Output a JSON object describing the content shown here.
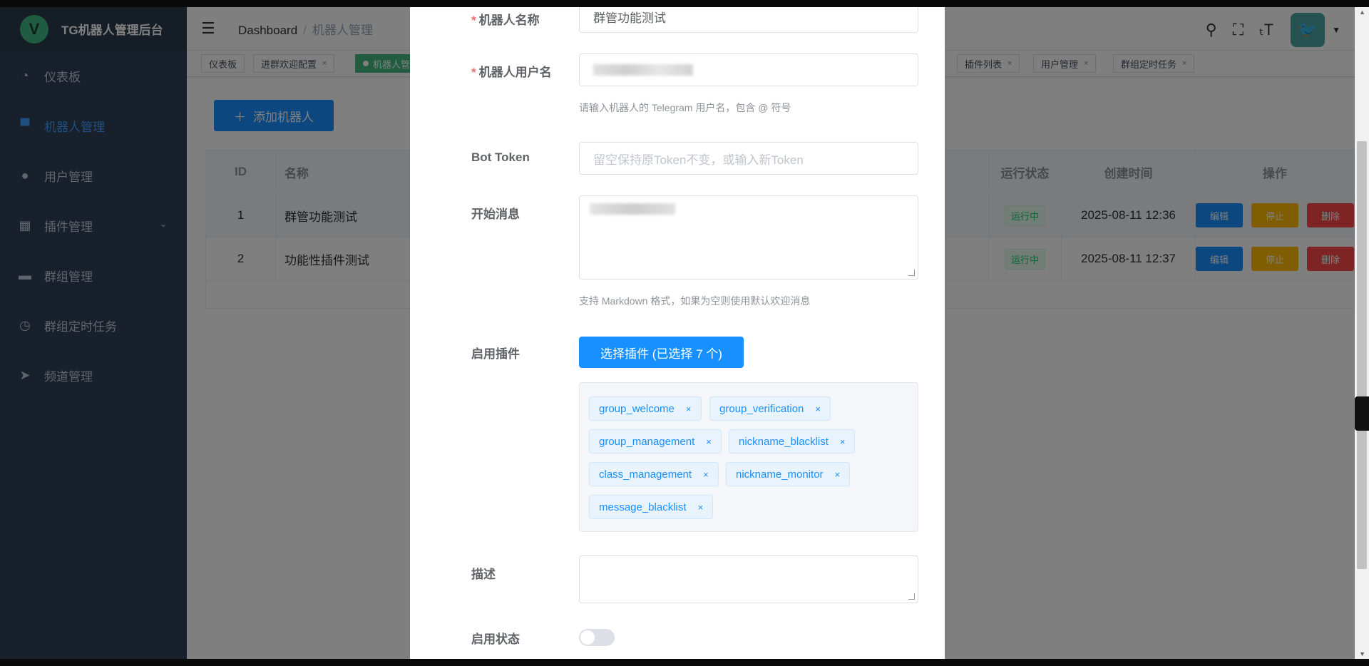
{
  "app": {
    "title": "TG机器人管理后台",
    "logo_letter": "V"
  },
  "sidebar": {
    "items": [
      {
        "label": "仪表板",
        "icon": "dashboard-icon",
        "glyph": "◔"
      },
      {
        "label": "机器人管理",
        "icon": "monitor-icon",
        "glyph": "▀"
      },
      {
        "label": "用户管理",
        "icon": "user-icon",
        "glyph": "●"
      },
      {
        "label": "插件管理",
        "icon": "grid-icon",
        "glyph": "▦"
      },
      {
        "label": "群组管理",
        "icon": "briefcase-icon",
        "glyph": "▬"
      },
      {
        "label": "群组定时任务",
        "icon": "clock-icon",
        "glyph": "◷"
      },
      {
        "label": "频道管理",
        "icon": "send-icon",
        "glyph": "➤"
      }
    ]
  },
  "navbar": {
    "breadcrumb_home": "Dashboard",
    "breadcrumb_sep": "/",
    "breadcrumb_current": "机器人管理"
  },
  "tagsview": {
    "tags": [
      "仪表板",
      "进群欢迎配置",
      "机器人管",
      "插件列表",
      "用户管理",
      "群组定时任务"
    ]
  },
  "page": {
    "add_button": "添加机器人",
    "table": {
      "headers": [
        "ID",
        "名称",
        "运行状态",
        "创建时间",
        "操作"
      ],
      "rows": [
        {
          "id": "1",
          "name": "群管功能测试",
          "status": "运行中",
          "created": "2025-08-11 12:36"
        },
        {
          "id": "2",
          "name": "功能性插件测试",
          "status": "运行中",
          "created": "2025-08-11 12:37"
        }
      ],
      "ops": {
        "edit": "编辑",
        "stop": "停止",
        "delete": "删除"
      }
    }
  },
  "dialog": {
    "name_label": "机器人名称",
    "name_value": "群管功能测试",
    "username_label": "机器人用户名",
    "username_help": "请输入机器人的 Telegram 用户名，包含 @ 符号",
    "token_label": "Bot Token",
    "token_placeholder": "留空保持原Token不变，或输入新Token",
    "start_label": "开始消息",
    "start_help": "支持 Markdown 格式，如果为空则使用默认欢迎消息",
    "plugins_label": "启用插件",
    "plugins_button": "选择插件 (已选择 7 个)",
    "plugins": [
      "group_welcome",
      "group_verification",
      "group_management",
      "nickname_blacklist",
      "class_management",
      "nickname_monitor",
      "message_blacklist"
    ],
    "desc_label": "描述",
    "enabled_label": "启用状态",
    "enabled": false
  }
}
